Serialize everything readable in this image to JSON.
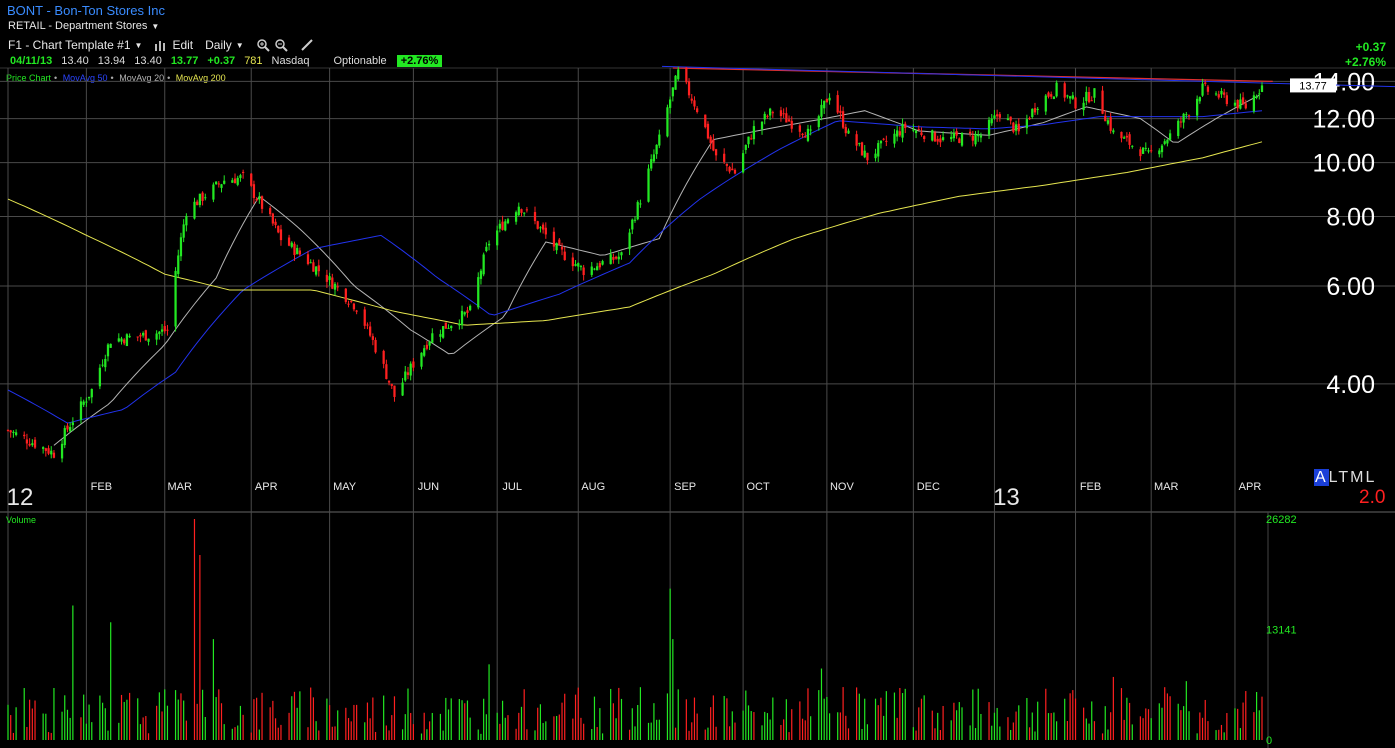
{
  "header": {
    "title": "BONT - Bon-Ton Stores Inc",
    "industry": "RETAIL - Department Stores"
  },
  "toolbar": {
    "template": "F1 - Chart Template #1",
    "edit": "Edit",
    "interval": "Daily"
  },
  "quote": {
    "date": "04/11/13",
    "open": "13.40",
    "high": "13.94",
    "low": "13.40",
    "close": "13.77",
    "change": "+0.37",
    "volume": "781",
    "exchange": "Nasdaq",
    "optionable": "Optionable",
    "pct_badge": "+2.76%"
  },
  "change_box": {
    "abs": "+0.37",
    "pct": "+2.76%"
  },
  "legend": {
    "price": "Price Chart",
    "ma50": "MovAvg 50",
    "ma20": "MovAvg 20",
    "ma200": "MovAvg 200",
    "sep": "•"
  },
  "volume_panel": {
    "label": "Volume"
  },
  "period_buttons": {
    "a": "A",
    "l": "L",
    "t": "T",
    "m": "M",
    "l2": "L"
  },
  "scale_text": "2.0",
  "colors": {
    "up": "#22e822",
    "down": "#ff2020",
    "ma20": "#b4b4b4",
    "ma50": "#2233ee",
    "ma200": "#e6e650",
    "trendline": "#dd3030",
    "grid": "#4a4a4a"
  },
  "chart_data": {
    "type": "candlestick",
    "title": "BONT - Bon-Ton Stores Inc",
    "period_start": "2012-01-03",
    "period_end": "2013-04-11",
    "interval": "daily",
    "y_ticks": [
      "4.00",
      "6.00",
      "8.00",
      "10.00",
      "12.00",
      "14.00"
    ],
    "ylim": [
      2.8,
      14.8
    ],
    "log_scale": true,
    "last_price_label": "13.77",
    "x_month_labels": [
      "12",
      "FEB",
      "MAR",
      "APR",
      "MAY",
      "JUN",
      "JUL",
      "AUG",
      "SEP",
      "OCT",
      "NOV",
      "DEC",
      "13",
      "FEB",
      "MAR",
      "APR"
    ],
    "x_year_labels": [
      "12",
      "13"
    ],
    "price_keyframes": [
      [
        "2012-01-03",
        3.3
      ],
      [
        "2012-01-20",
        3.0
      ],
      [
        "2012-02-03",
        3.9
      ],
      [
        "2012-02-10",
        4.8
      ],
      [
        "2012-02-24",
        4.9
      ],
      [
        "2012-03-02",
        5.0
      ],
      [
        "2012-03-09",
        8.2
      ],
      [
        "2012-03-23",
        9.3
      ],
      [
        "2012-03-30",
        9.4
      ],
      [
        "2012-04-13",
        7.3
      ],
      [
        "2012-04-27",
        6.4
      ],
      [
        "2012-05-11",
        5.5
      ],
      [
        "2012-05-25",
        3.8
      ],
      [
        "2012-06-08",
        4.9
      ],
      [
        "2012-06-22",
        5.4
      ],
      [
        "2012-06-29",
        7.2
      ],
      [
        "2012-07-10",
        8.4
      ],
      [
        "2012-07-24",
        7.0
      ],
      [
        "2012-08-03",
        6.4
      ],
      [
        "2012-08-17",
        6.8
      ],
      [
        "2012-08-24",
        8.6
      ],
      [
        "2012-08-31",
        11.0
      ],
      [
        "2012-09-07",
        14.5
      ],
      [
        "2012-09-14",
        12.5
      ],
      [
        "2012-09-21",
        10.2
      ],
      [
        "2012-09-28",
        9.6
      ],
      [
        "2012-10-05",
        11.5
      ],
      [
        "2012-10-12",
        12.4
      ],
      [
        "2012-10-26",
        11.2
      ],
      [
        "2012-11-02",
        13.3
      ],
      [
        "2012-11-09",
        11.2
      ],
      [
        "2012-11-16",
        10.2
      ],
      [
        "2012-11-30",
        11.6
      ],
      [
        "2012-12-14",
        11.0
      ],
      [
        "2012-12-28",
        11.2
      ],
      [
        "2013-01-04",
        12.3
      ],
      [
        "2013-01-11",
        11.3
      ],
      [
        "2013-01-18",
        12.8
      ],
      [
        "2013-01-25",
        13.6
      ],
      [
        "2013-02-01",
        12.8
      ],
      [
        "2013-02-08",
        13.3
      ],
      [
        "2013-02-15",
        11.3
      ],
      [
        "2013-02-28",
        10.3
      ],
      [
        "2013-03-08",
        11.2
      ],
      [
        "2013-03-15",
        12.4
      ],
      [
        "2013-03-20",
        13.6
      ],
      [
        "2013-04-01",
        12.8
      ],
      [
        "2013-04-05",
        12.6
      ],
      [
        "2013-04-11",
        13.77
      ]
    ],
    "series": [
      {
        "name": "MovAvg 20",
        "keyframes": [
          [
            "2012-01-20",
            3.1
          ],
          [
            "2012-02-10",
            3.7
          ],
          [
            "2012-03-01",
            4.7
          ],
          [
            "2012-03-20",
            6.2
          ],
          [
            "2012-04-05",
            8.7
          ],
          [
            "2012-04-20",
            7.6
          ],
          [
            "2012-05-10",
            6.0
          ],
          [
            "2012-05-31",
            5.0
          ],
          [
            "2012-06-15",
            4.5
          ],
          [
            "2012-07-05",
            5.3
          ],
          [
            "2012-07-20",
            7.2
          ],
          [
            "2012-08-10",
            6.8
          ],
          [
            "2012-08-31",
            7.3
          ],
          [
            "2012-09-20",
            11.0
          ],
          [
            "2012-10-10",
            11.5
          ],
          [
            "2012-10-31",
            12.0
          ],
          [
            "2012-11-15",
            12.4
          ],
          [
            "2012-12-05",
            11.4
          ],
          [
            "2012-12-31",
            11.2
          ],
          [
            "2013-01-20",
            11.8
          ],
          [
            "2013-02-05",
            12.6
          ],
          [
            "2013-02-25",
            12.0
          ],
          [
            "2013-03-10",
            10.8
          ],
          [
            "2013-03-25",
            12.0
          ],
          [
            "2013-04-11",
            13.3
          ]
        ]
      },
      {
        "name": "MovAvg 50",
        "keyframes": [
          [
            "2012-01-03",
            3.9
          ],
          [
            "2012-01-25",
            3.4
          ],
          [
            "2012-02-15",
            3.6
          ],
          [
            "2012-03-05",
            4.2
          ],
          [
            "2012-03-30",
            5.9
          ],
          [
            "2012-04-25",
            7.0
          ],
          [
            "2012-05-20",
            7.4
          ],
          [
            "2012-06-10",
            6.2
          ],
          [
            "2012-06-30",
            5.3
          ],
          [
            "2012-07-25",
            5.8
          ],
          [
            "2012-08-20",
            6.6
          ],
          [
            "2012-09-15",
            8.6
          ],
          [
            "2012-10-15",
            10.6
          ],
          [
            "2012-11-05",
            11.9
          ],
          [
            "2012-12-05",
            11.6
          ],
          [
            "2012-12-31",
            11.5
          ],
          [
            "2013-01-20",
            11.7
          ],
          [
            "2013-02-10",
            12.1
          ],
          [
            "2013-03-01",
            12.1
          ],
          [
            "2013-03-20",
            12.1
          ],
          [
            "2013-04-11",
            12.4
          ]
        ]
      },
      {
        "name": "MovAvg 200",
        "keyframes": [
          [
            "2012-01-03",
            8.6
          ],
          [
            "2012-02-01",
            7.4
          ],
          [
            "2012-03-01",
            6.3
          ],
          [
            "2012-03-25",
            5.9
          ],
          [
            "2012-04-25",
            5.9
          ],
          [
            "2012-05-25",
            5.4
          ],
          [
            "2012-06-20",
            5.1
          ],
          [
            "2012-07-20",
            5.2
          ],
          [
            "2012-08-20",
            5.5
          ],
          [
            "2012-09-20",
            6.3
          ],
          [
            "2012-10-20",
            7.3
          ],
          [
            "2012-11-20",
            8.1
          ],
          [
            "2012-12-20",
            8.7
          ],
          [
            "2013-01-20",
            9.1
          ],
          [
            "2013-02-20",
            9.6
          ],
          [
            "2013-03-20",
            10.2
          ],
          [
            "2013-04-11",
            10.9
          ]
        ]
      },
      {
        "name": "Trendline",
        "points": [
          [
            "2012-09-05",
            14.8
          ],
          [
            "2013-04-15",
            14.0
          ]
        ]
      }
    ],
    "volume": {
      "label": "Volume",
      "y_ticks": [
        "0",
        "13141",
        "26282"
      ],
      "ylim": [
        0,
        26282
      ],
      "spikes": [
        [
          "2012-01-27",
          16000
        ],
        [
          "2012-02-10",
          14000
        ],
        [
          "2012-03-12",
          26282
        ],
        [
          "2012-03-14",
          22000
        ],
        [
          "2012-03-19",
          12000
        ],
        [
          "2012-09-04",
          18000
        ],
        [
          "2012-09-05",
          12000
        ],
        [
          "2012-06-29",
          9000
        ],
        [
          "2012-10-30",
          8500
        ],
        [
          "2013-02-15",
          7500
        ],
        [
          "2013-03-14",
          7000
        ]
      ],
      "typical": 3500
    }
  }
}
